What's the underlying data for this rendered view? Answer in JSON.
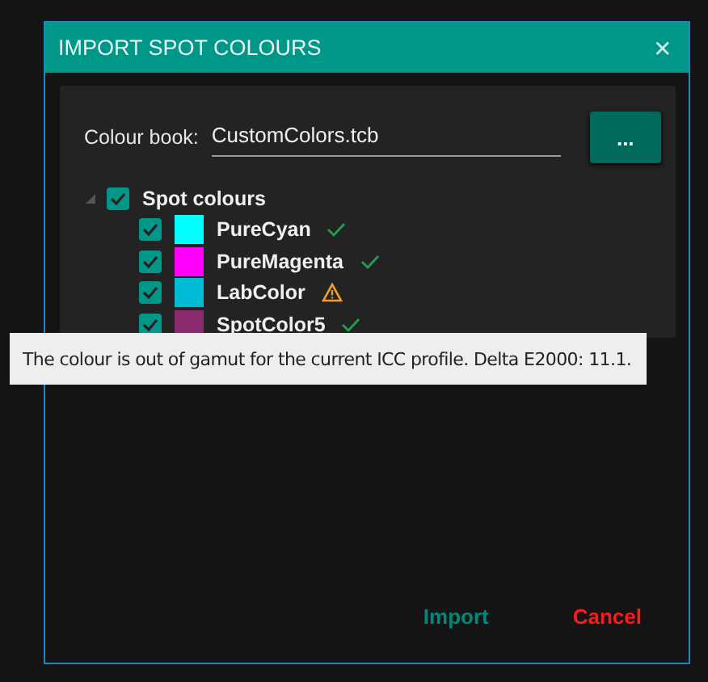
{
  "window": {
    "title": "IMPORT SPOT COLOURS",
    "close": "✕"
  },
  "colour_book": {
    "label": "Colour book:",
    "value": "CustomColors.tcb",
    "browse": "..."
  },
  "tree": {
    "label": "Spot colours",
    "checked": true,
    "expanded": true,
    "children": [
      {
        "name": "PureCyan",
        "checked": true,
        "color": "#00ffff",
        "kind": "ok"
      },
      {
        "name": "PureMagenta",
        "checked": true,
        "color": "#ff00ff",
        "kind": "ok"
      },
      {
        "name": "LabColor",
        "checked": true,
        "color": "#00bcd4",
        "kind": "warning"
      },
      {
        "name": "SpotColor5",
        "checked": true,
        "color": "#8b2a6e",
        "kind": "ok"
      }
    ]
  },
  "tooltip": "The colour is out of gamut for the current ICC profile. Delta E2000: 11.1.",
  "buttons": [
    {
      "label": "Import",
      "kind": "primary"
    },
    {
      "label": "Cancel",
      "kind": "danger"
    }
  ]
}
